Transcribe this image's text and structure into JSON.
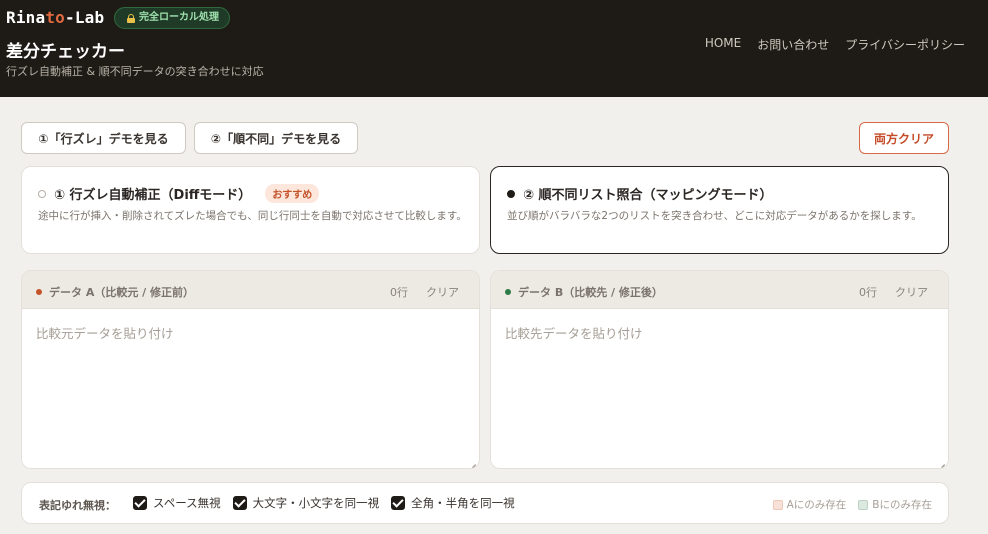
{
  "header": {
    "logo": {
      "prefix": "Rina",
      "accent": "to",
      "suffix": "-Lab"
    },
    "badge": "完全ローカル処理",
    "title": "差分チェッカー",
    "subtitle": "行ズレ自動補正 & 順不同データの突き合わせに対応",
    "nav": [
      "HOME",
      "お問い合わせ",
      "プライバシーポリシー"
    ]
  },
  "toolbar": {
    "demo1_label": "①「行ズレ」デモを見る",
    "demo2_label": "②「順不同」デモを見る",
    "clear_all_label": "両方クリア"
  },
  "modes": [
    {
      "title": "① 行ズレ自動補正（Diffモード）",
      "badge": "おすすめ",
      "description": "途中に行が挿入・削除されてズレた場合でも、同じ行同士を自動で対応させて比較します。",
      "selected": false
    },
    {
      "title": "② 順不同リスト照合（マッピングモード）",
      "description": "並び順がバラバラな2つのリストを突き合わせ、どこに対応データがあるかを探します。",
      "selected": true
    }
  ],
  "panels": {
    "a": {
      "label": "データ A（比較元 / 修正前）",
      "lines": "0行",
      "clear": "クリア",
      "placeholder": "比較元データを貼り付け",
      "value": "",
      "dot_color": "#c4532a"
    },
    "b": {
      "label": "データ B（比較先 / 修正後）",
      "lines": "0行",
      "clear": "クリア",
      "placeholder": "比較先データを貼り付け",
      "value": "",
      "dot_color": "#2f7a44"
    }
  },
  "options": {
    "label": "表記ゆれ無視：",
    "items": [
      {
        "label": "スペース無視",
        "checked": true
      },
      {
        "label": "大文字・小文字を同一視",
        "checked": true
      },
      {
        "label": "全角・半角を同一視",
        "checked": true
      }
    ],
    "legend": [
      {
        "label": "Aにのみ存在",
        "color": "#f7e1d9"
      },
      {
        "label": "Bにのみ存在",
        "color": "#dce9e0"
      }
    ]
  },
  "colors": {
    "accent": "#e06a3f",
    "header_bg": "#1e1b17",
    "page_bg": "#f2f0ec"
  }
}
